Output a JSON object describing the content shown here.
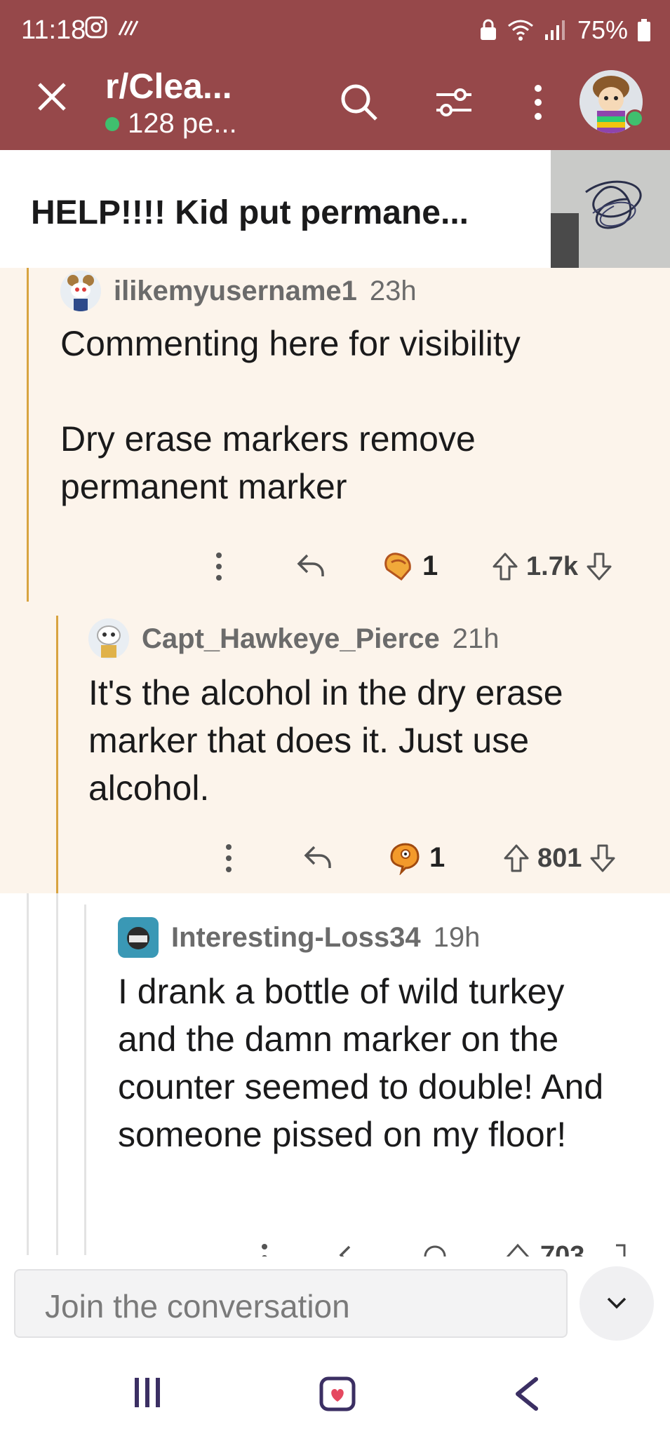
{
  "status_bar": {
    "time": "11:18",
    "battery": "75%"
  },
  "header": {
    "title": "r/Clea...",
    "members": "128 pe..."
  },
  "post": {
    "title": "HELP!!!! Kid put permane..."
  },
  "comments": [
    {
      "username": "ilikemyusername1",
      "time": "23h",
      "body": "Commenting here for visibility\n\nDry erase markers remove permanent marker",
      "award_count": "1",
      "votes": "1.7k"
    },
    {
      "username": "Capt_Hawkeye_Pierce",
      "time": "21h",
      "body": "It's the alcohol in the dry erase marker that does it. Just use alcohol.",
      "award_count": "1",
      "votes": "801"
    },
    {
      "username": "Interesting-Loss34",
      "time": "19h",
      "body": "I drank a bottle of wild turkey and the damn marker on the counter seemed to double! And someone pissed on my floor!",
      "votes": "703"
    }
  ],
  "composer": {
    "placeholder": "Join the conversation"
  },
  "colors": {
    "header_bg": "#96484a",
    "thread_bg": "#fcf4eb",
    "thread_line": "#d8a441",
    "online": "#3fbf6e"
  },
  "icons": [
    "close-icon",
    "search-icon",
    "filter-icon",
    "more-icon",
    "share-icon",
    "award-icon",
    "upvote-icon",
    "downvote-icon",
    "chevron-down-icon",
    "recent-apps-icon",
    "home-icon",
    "back-icon"
  ]
}
